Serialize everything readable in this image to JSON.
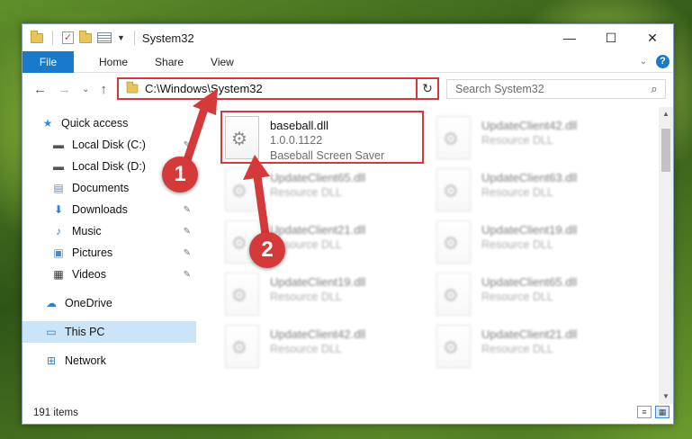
{
  "window": {
    "title": "System32",
    "controls": {
      "minimize": "—",
      "maximize": "☐",
      "close": "✕"
    }
  },
  "ribbon": {
    "tabs": [
      "File",
      "Home",
      "Share",
      "View"
    ],
    "help": "?"
  },
  "address": {
    "path": "C:\\Windows\\System32",
    "search_placeholder": "Search System32"
  },
  "sidebar": {
    "items": [
      {
        "label": "Quick access",
        "icon": "star-icon"
      },
      {
        "label": "Local Disk (C:)",
        "icon": "drive-icon"
      },
      {
        "label": "Local Disk (D:)",
        "icon": "drive-icon"
      },
      {
        "label": "Documents",
        "icon": "documents-icon"
      },
      {
        "label": "Downloads",
        "icon": "download-icon"
      },
      {
        "label": "Music",
        "icon": "music-icon"
      },
      {
        "label": "Pictures",
        "icon": "pictures-icon"
      },
      {
        "label": "Videos",
        "icon": "videos-icon"
      },
      {
        "label": "OneDrive",
        "icon": "cloud-icon"
      },
      {
        "label": "This PC",
        "icon": "computer-icon"
      },
      {
        "label": "Network",
        "icon": "network-icon"
      }
    ]
  },
  "files": [
    {
      "name": "baseball.dll",
      "line2": "1.0.0.1122",
      "line3": "Baseball Screen Saver"
    },
    {
      "name": "UpdateClient42.dll",
      "line2": "Resource DLL"
    },
    {
      "name": "UpdateClient65.dll",
      "line2": "Resource DLL"
    },
    {
      "name": "UpdateClient63.dll",
      "line2": "Resource DLL"
    },
    {
      "name": "UpdateClient21.dll",
      "line2": "Resource DLL"
    },
    {
      "name": "UpdateClient19.dll",
      "line2": "Resource DLL"
    },
    {
      "name": "UpdateClient19.dll",
      "line2": "Resource DLL"
    },
    {
      "name": "UpdateClient65.dll",
      "line2": "Resource DLL"
    },
    {
      "name": "UpdateClient42.dll",
      "line2": "Resource DLL"
    },
    {
      "name": "UpdateClient21.dll",
      "line2": "Resource DLL"
    }
  ],
  "status": {
    "count": "191 items"
  },
  "callouts": [
    "1",
    "2"
  ],
  "colors": {
    "accent": "#1979ca",
    "highlight": "#d7373a",
    "selected": "#cce4f7"
  }
}
